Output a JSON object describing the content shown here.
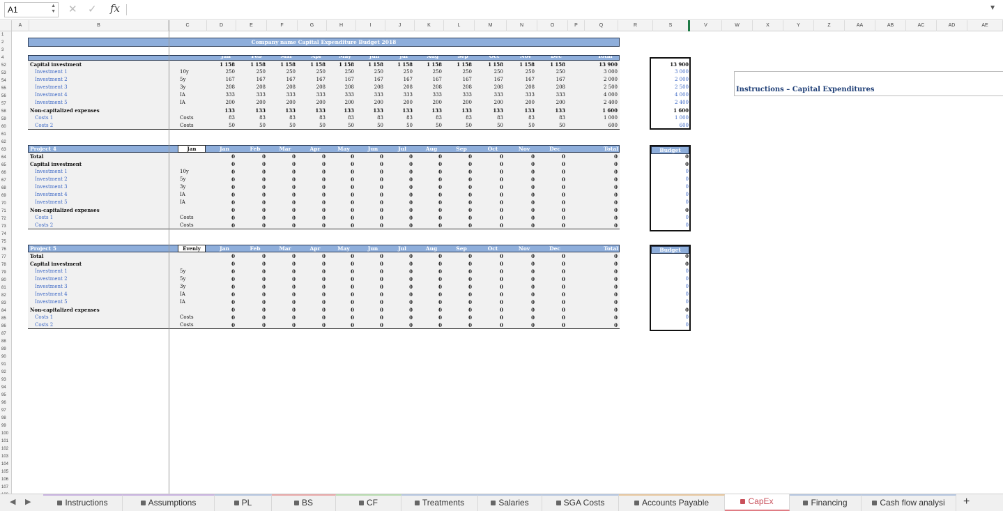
{
  "formula_bar": {
    "cell_ref": "A1",
    "fx": "fx",
    "cancel": "✕",
    "confirm": "✓",
    "drop": "▼"
  },
  "columns": [
    "A",
    "B",
    "C",
    "D",
    "E",
    "F",
    "G",
    "H",
    "I",
    "J",
    "K",
    "L",
    "M",
    "N",
    "O",
    "P",
    "Q",
    "R",
    "S",
    "V",
    "W",
    "X",
    "Y",
    "Z",
    "AA",
    "AB",
    "AC",
    "AD",
    "AE"
  ],
  "rows": [
    "1",
    "2",
    "3",
    "4",
    "52",
    "53",
    "54",
    "55",
    "56",
    "57",
    "58",
    "59",
    "60",
    "61",
    "62",
    "63",
    "64",
    "65",
    "66",
    "67",
    "68",
    "69",
    "70",
    "71",
    "72",
    "73",
    "74",
    "75",
    "76",
    "77",
    "78",
    "79",
    "80",
    "81",
    "82",
    "83",
    "84",
    "85",
    "86",
    "87",
    "88",
    "89",
    "90",
    "91",
    "92",
    "93",
    "94",
    "95",
    "96",
    "97",
    "98",
    "99",
    "100",
    "101",
    "102",
    "103",
    "104",
    "105",
    "106",
    "107",
    "108"
  ],
  "title": "Company name Capital Expenditure Budget 2018",
  "months": [
    "Jan",
    "Feb",
    "Mar",
    "Apr",
    "May",
    "Jun",
    "Jul",
    "Aug",
    "Sep",
    "Oct",
    "Nov",
    "Dec"
  ],
  "total_label": "Total",
  "budget_label": "Budget",
  "instructions_title": "Instructions – Capital Expenditures",
  "block1": {
    "rows": [
      {
        "label": "Capital investment",
        "c": "",
        "vals": [
          "1 158",
          "1 158",
          "1 158",
          "1 158",
          "1 158",
          "1 158",
          "1 158",
          "1 158",
          "1 158",
          "1 158",
          "1 158",
          "1 158"
        ],
        "total": "13 900",
        "budget": "13 900",
        "bold": true,
        "blue": false
      },
      {
        "label": "Investment 1",
        "c": "10y",
        "vals": [
          "250",
          "250",
          "250",
          "250",
          "250",
          "250",
          "250",
          "250",
          "250",
          "250",
          "250",
          "250"
        ],
        "total": "3 000",
        "budget": "3 000",
        "bold": false,
        "blue": true
      },
      {
        "label": "Investment 2",
        "c": "5y",
        "vals": [
          "167",
          "167",
          "167",
          "167",
          "167",
          "167",
          "167",
          "167",
          "167",
          "167",
          "167",
          "167"
        ],
        "total": "2 000",
        "budget": "2 000",
        "bold": false,
        "blue": true
      },
      {
        "label": "Investment 3",
        "c": "3y",
        "vals": [
          "208",
          "208",
          "208",
          "208",
          "208",
          "208",
          "208",
          "208",
          "208",
          "208",
          "208",
          "208"
        ],
        "total": "2 500",
        "budget": "2 500",
        "bold": false,
        "blue": true
      },
      {
        "label": "Investment 4",
        "c": "IA",
        "vals": [
          "333",
          "333",
          "333",
          "333",
          "333",
          "333",
          "333",
          "333",
          "333",
          "333",
          "333",
          "333"
        ],
        "total": "4 000",
        "budget": "4 000",
        "bold": false,
        "blue": true
      },
      {
        "label": "Investment 5",
        "c": "IA",
        "vals": [
          "200",
          "200",
          "200",
          "200",
          "200",
          "200",
          "200",
          "200",
          "200",
          "200",
          "200",
          "200"
        ],
        "total": "2 400",
        "budget": "2 400",
        "bold": false,
        "blue": true
      },
      {
        "label": "Non-capitalized expenses",
        "c": "",
        "vals": [
          "133",
          "133",
          "133",
          "133",
          "133",
          "133",
          "133",
          "133",
          "133",
          "133",
          "133",
          "133"
        ],
        "total": "1 600",
        "budget": "1 600",
        "bold": true,
        "blue": false
      },
      {
        "label": "Costs 1",
        "c": "Costs",
        "vals": [
          "83",
          "83",
          "83",
          "83",
          "83",
          "83",
          "83",
          "83",
          "83",
          "83",
          "83",
          "83"
        ],
        "total": "1 000",
        "budget": "1 000",
        "bold": false,
        "blue": true
      },
      {
        "label": "Costs 2",
        "c": "Costs",
        "vals": [
          "50",
          "50",
          "50",
          "50",
          "50",
          "50",
          "50",
          "50",
          "50",
          "50",
          "50",
          "50"
        ],
        "total": "600",
        "budget": "600",
        "bold": false,
        "blue": true
      }
    ]
  },
  "block2": {
    "name": "Project 4",
    "mode": "Jan",
    "rows": [
      {
        "label": "Total",
        "c": "",
        "bold": true,
        "blue": false
      },
      {
        "label": "Capital investment",
        "c": "",
        "bold": true,
        "blue": false
      },
      {
        "label": "Investment 1",
        "c": "10y",
        "bold": false,
        "blue": true
      },
      {
        "label": "Investment 2",
        "c": "5y",
        "bold": false,
        "blue": true
      },
      {
        "label": "Investment 3",
        "c": "3y",
        "bold": false,
        "blue": true
      },
      {
        "label": "Investment 4",
        "c": "IA",
        "bold": false,
        "blue": true
      },
      {
        "label": "Investment 5",
        "c": "IA",
        "bold": false,
        "blue": true
      },
      {
        "label": "Non-capitalized expenses",
        "c": "",
        "bold": true,
        "blue": false
      },
      {
        "label": "Costs 1",
        "c": "Costs",
        "bold": false,
        "blue": true
      },
      {
        "label": "Costs 2",
        "c": "Costs",
        "bold": false,
        "blue": true
      }
    ]
  },
  "block3": {
    "name": "Project 5",
    "mode": "Evenly",
    "rows": [
      {
        "label": "Total",
        "c": "",
        "bold": true,
        "blue": false
      },
      {
        "label": "Capital investment",
        "c": "",
        "bold": true,
        "blue": false
      },
      {
        "label": "Investment 1",
        "c": "5y",
        "bold": false,
        "blue": true
      },
      {
        "label": "Investment 2",
        "c": "5y",
        "bold": false,
        "blue": true
      },
      {
        "label": "Investment 3",
        "c": "3y",
        "bold": false,
        "blue": true
      },
      {
        "label": "Investment 4",
        "c": "IA",
        "bold": false,
        "blue": true
      },
      {
        "label": "Investment 5",
        "c": "IA",
        "bold": false,
        "blue": true
      },
      {
        "label": "Non-capitalized expenses",
        "c": "",
        "bold": true,
        "blue": false
      },
      {
        "label": "Costs 1",
        "c": "Costs",
        "bold": false,
        "blue": true
      },
      {
        "label": "Costs 2",
        "c": "Costs",
        "bold": false,
        "blue": true
      }
    ]
  },
  "zero": "0",
  "tabs": [
    "Instructions",
    "Assumptions",
    "PL",
    "BS",
    "CF",
    "Treatments",
    "Salaries",
    "SGA Costs",
    "Accounts Payable",
    "CapEx",
    "Financing",
    "Cash flow analysi"
  ],
  "active_tab": "CapEx",
  "tab_nav": {
    "prev": "◀",
    "next": "▶",
    "add": "+",
    "lock": "🔒"
  },
  "colors": {
    "band": "#8eaedb",
    "blue_text": "#3a66c4",
    "active_tab": "#c9505a",
    "tab_accents": [
      "#c9b3e0",
      "#c9b3e0",
      "#b6c6e0",
      "#e8a8a8",
      "#b8dcb0",
      "#b6c6e0",
      "#b6c6e0",
      "#b6c6e0",
      "#e8c8a0",
      "#e07c84",
      "#b6c6e0",
      "#b6c6e0"
    ]
  }
}
